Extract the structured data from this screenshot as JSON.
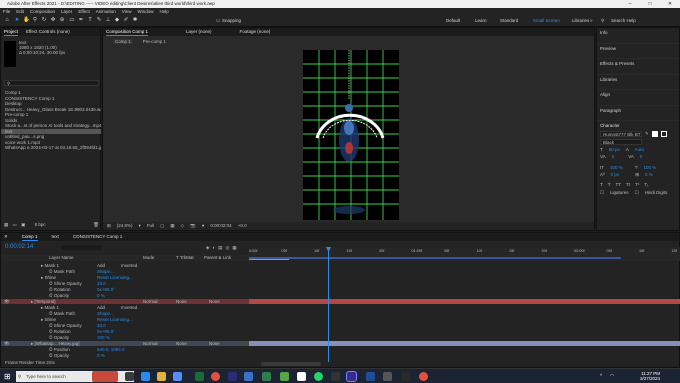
{
  "window": {
    "title": "Adobe After Effects 2021 - D:\\EDITING ----- VIDEO editing\\Client Desires\\alien third world\\third work.aep",
    "min": "–",
    "max": "□",
    "close": "✕"
  },
  "menu": [
    "File",
    "Edit",
    "Composition",
    "Layer",
    "Effect",
    "Animation",
    "View",
    "Window",
    "Help"
  ],
  "toolbar": {
    "snapping": "Snapping",
    "workspaces": [
      "Default",
      "Learn",
      "Standard",
      "Small Screen",
      "Libraries"
    ],
    "active_workspace": "Small Screen",
    "search_placeholder": "Search Help"
  },
  "project": {
    "tab": "Project",
    "effect_controls": "Effect Controls (none)",
    "thumb_name": "text",
    "thumb_info": [
      "1080 x 1920 (1.00)",
      "Δ 0:00:10:24, 30.00 fps"
    ],
    "items": [
      "Comp 1",
      "CONSISTENCY Comp 1",
      "Desktop",
      "Destruct... Heavy_Glass Break 1E.9903.0436.wav",
      "Pre-comp 1",
      "Solids",
      "Stock a...st of person AI tools and strategy...mp4",
      "text",
      "untitled_pau...s.png",
      "voice work 1.mp3",
      "WhatsApp a 2024-03-17 at 03.19.55_2f094fd1.jpg"
    ],
    "selected": "text",
    "bpc": "8 bpc"
  },
  "composition": {
    "tab": "Composition Comp 1",
    "subtabs": [
      "Comp 1",
      "Pre-comp 1"
    ],
    "layer_tab": "Layer (none)",
    "footage_tab": "Footage (none)",
    "zoom": "(24.8%)",
    "quality": "Full",
    "timecode": "0:00:02:04",
    "exposure": "+0.0"
  },
  "right_panels": [
    "Info",
    "Preview",
    "Effects & Presets",
    "Libraries",
    "Align",
    "Paragraph"
  ],
  "character": {
    "title": "Character",
    "font": "Humnst777 Blk BT",
    "style": "Black",
    "size": "50 px",
    "leading": "Auto",
    "kerning": "0",
    "tracking": "0",
    "scale_v": "100 %",
    "scale_h": "100 %",
    "baseline": "0 px",
    "tsume": "0 %",
    "ligatures": "Ligatures",
    "hindi": "Hindi Digits"
  },
  "timeline": {
    "tabs": [
      "Comp 1",
      "text",
      "CONSISTENCY Comp 1"
    ],
    "timecode": "0:00:02:14",
    "columns": [
      "Layer Name",
      "Mode",
      "T TrkMat",
      "Parent & Link"
    ],
    "rows": [
      {
        "name": "Mask 1",
        "kind": "sub",
        "mode": "Add",
        "extra": "Inverted"
      },
      {
        "name": "Mask Path",
        "kind": "prop",
        "value": "Shape..."
      },
      {
        "name": "Shine",
        "kind": "sub",
        "value": "Reset Licensing..."
      },
      {
        "name": "Shine Opacity",
        "kind": "prop",
        "value": "33.0"
      },
      {
        "name": "Rotation",
        "kind": "prop",
        "value": "0x+90.0°"
      },
      {
        "name": "Opacity",
        "kind": "prop",
        "value": "0 %"
      },
      {
        "name": "[Temporal]",
        "kind": "layer-red",
        "mode": "Normal",
        "trk": "None",
        "parent": "None"
      },
      {
        "name": "Mask 1",
        "kind": "sub",
        "mode": "Add",
        "extra": "Inverted"
      },
      {
        "name": "Mask Path",
        "kind": "prop",
        "value": "Shape..."
      },
      {
        "name": "Shine",
        "kind": "sub",
        "value": "Reset Licensing..."
      },
      {
        "name": "Shine Opacity",
        "kind": "prop",
        "value": "33.0"
      },
      {
        "name": "Rotation",
        "kind": "prop",
        "value": "0x+90.0°"
      },
      {
        "name": "Opacity",
        "kind": "prop",
        "value": "100 %"
      },
      {
        "name": "[Whatsap... Heavy.jpg]",
        "kind": "layer-sel",
        "mode": "Normal",
        "trk": "None",
        "parent": "None"
      },
      {
        "name": "Position",
        "kind": "prop",
        "value": "540.0, 1094.0"
      },
      {
        "name": "Opacity",
        "kind": "prop",
        "value": "0 %"
      }
    ],
    "ruler": [
      "0:00f",
      "05f",
      "10f",
      "15f",
      "20f",
      "01:00f",
      "05f",
      "10f",
      "15f",
      "20f",
      "02:00f",
      "05f",
      "10f",
      "15f"
    ],
    "footer": "Frame Render Time 2ms"
  },
  "taskbar": {
    "search": "Type here to search",
    "time": "11:27 PM",
    "date": "3/27/2024"
  },
  "colors": {
    "accent": "#2d8ceb",
    "green_grid": "#3cd24a",
    "red_layer": "#b24848"
  }
}
